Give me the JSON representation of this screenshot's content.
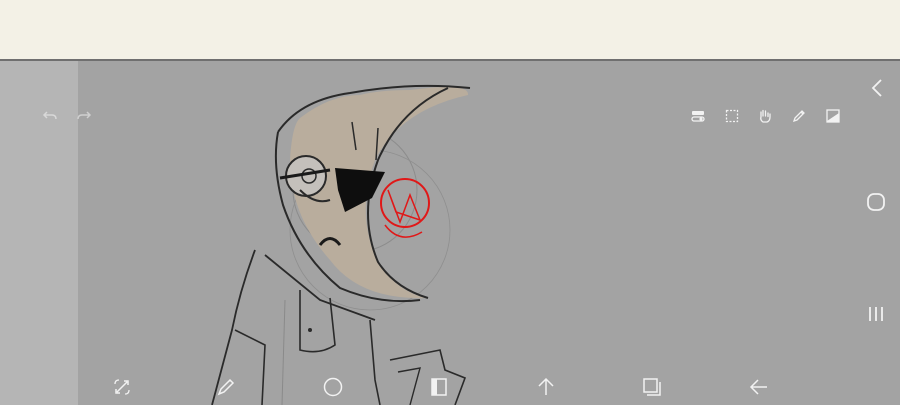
{
  "app": {
    "icons": {
      "undo": "undo-icon",
      "redo": "redo-icon",
      "layer_toggle": "layer-toggle-icon",
      "selection": "selection-icon",
      "hand": "hand-icon",
      "pen": "pen-icon",
      "image_adjust": "image-adjust-icon"
    }
  },
  "bottom_toolbar": {
    "icons": [
      "transform-icon",
      "brush-icon",
      "circle-tool-icon",
      "layers-panel-icon",
      "arrow-up-icon",
      "layers-stack-icon",
      "arrow-left-icon"
    ]
  },
  "system_nav": {
    "icons": [
      "back-icon",
      "home-icon",
      "recents-icon"
    ]
  },
  "colors": {
    "topbar": "#f3f1e6",
    "canvas": "#a3a3a3",
    "left_strip": "#b5b5b5",
    "icon": "#f2f2f2",
    "accent_sketch": "#e01818",
    "fill_tan": "#b9ad9d"
  }
}
